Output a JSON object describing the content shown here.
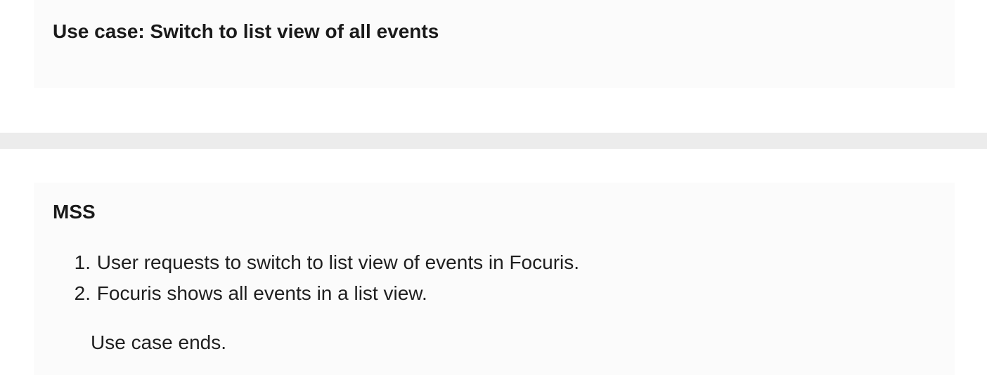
{
  "use_case": {
    "title": "Use case: Switch to list view of all events"
  },
  "mss": {
    "heading": "MSS",
    "steps": [
      {
        "number": "1.",
        "text": "User requests to switch to list view of events in Focuris."
      },
      {
        "number": "2.",
        "text": "Focuris shows all events in a list view."
      }
    ],
    "ending": "Use case ends."
  },
  "colors": {
    "card_background": "#fbfbfb",
    "divider": "#ececec",
    "text": "#1f1f1f"
  }
}
